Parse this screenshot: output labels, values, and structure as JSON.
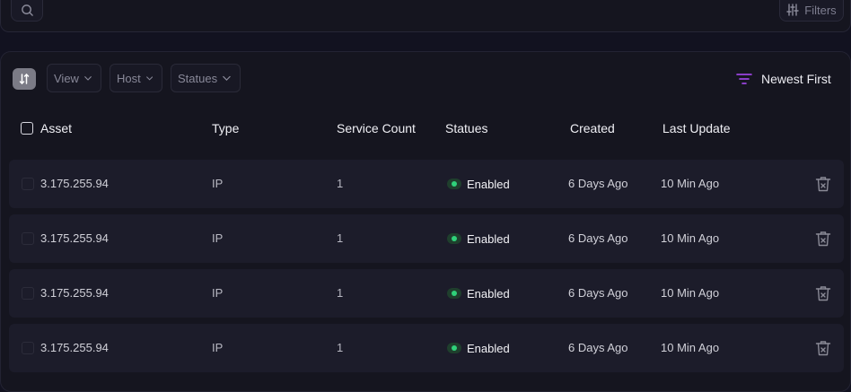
{
  "toolbar": {
    "search_icon": "search-icon",
    "filters_label": "Filters",
    "filters_icon": "sliders-icon"
  },
  "table_controls": {
    "sort_toggle_icon": "sort-toggle-icon",
    "view_label": "View",
    "host_label": "Host",
    "statues_label": "Statues",
    "sort_icon": "sort-lines-icon",
    "sort_label": "Newest First",
    "accent_color": "#b14cff"
  },
  "table": {
    "columns": {
      "asset": "Asset",
      "type": "Type",
      "service_count": "Service Count",
      "statues": "Statues",
      "created": "Created",
      "last_update": "Last Update"
    },
    "rows": [
      {
        "asset": "3.175.255.94",
        "type": "IP",
        "service_count": "1",
        "status": "Enabled",
        "created": "6 Days Ago",
        "last_update": "10 Min Ago"
      },
      {
        "asset": "3.175.255.94",
        "type": "IP",
        "service_count": "1",
        "status": "Enabled",
        "created": "6 Days Ago",
        "last_update": "10 Min Ago"
      },
      {
        "asset": "3.175.255.94",
        "type": "IP",
        "service_count": "1",
        "status": "Enabled",
        "created": "6 Days Ago",
        "last_update": "10 Min Ago"
      },
      {
        "asset": "3.175.255.94",
        "type": "IP",
        "service_count": "1",
        "status": "Enabled",
        "created": "6 Days Ago",
        "last_update": "10 Min Ago"
      }
    ],
    "status_color": "#2fd17a",
    "row_action_icon": "trash-icon"
  }
}
